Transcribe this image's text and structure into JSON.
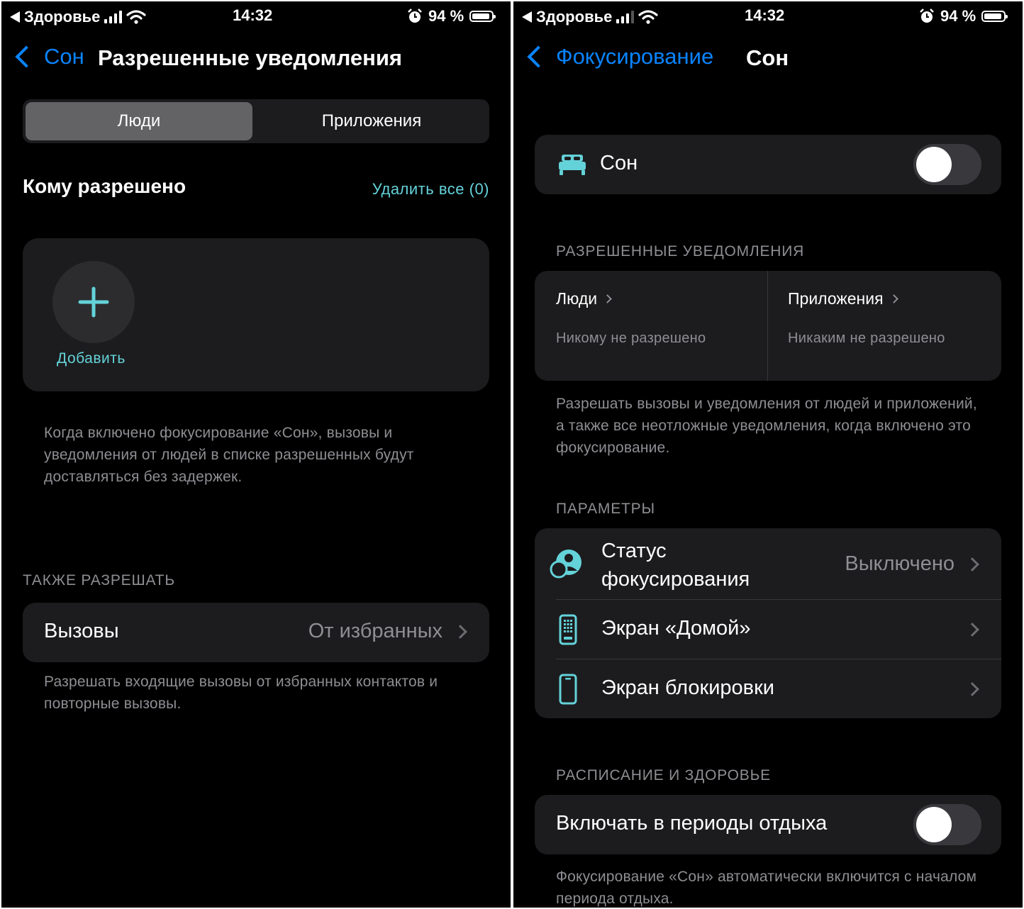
{
  "left_screen": {
    "status_bar": {
      "back_app": "Здоровье",
      "time": "14:32",
      "battery": "94 %",
      "battery_level": 0.94
    },
    "nav": {
      "back_label": "Сон",
      "title": "Разрешенные уведомления"
    },
    "segmented": {
      "tab_people": "Люди",
      "tab_apps": "Приложения",
      "selected": "Люди"
    },
    "allowed_section": {
      "title": "Кому разрешено",
      "remove_all": "Удалить все (0)"
    },
    "add_card": {
      "add_label": "Добавить"
    },
    "info_caption": "Когда включено фокусирование «Сон», вызовы и уведомления от людей в списке разрешенных будут доставляться без задержек.",
    "also_allow": {
      "header": "ТАКЖЕ РАЗРЕШАТЬ",
      "calls_label": "Вызовы",
      "calls_value": "От избранных",
      "caption": "Разрешать входящие вызовы от избранных контактов и повторные вызовы."
    }
  },
  "right_screen": {
    "status_bar": {
      "back_app": "Здоровье",
      "time": "14:32",
      "battery": "94 %",
      "battery_level": 0.94
    },
    "nav": {
      "back_label": "Фокусирование",
      "title": "Сон"
    },
    "sleep_row": {
      "label": "Сон",
      "toggle_on": false
    },
    "allowed_notifications": {
      "header": "РАЗРЕШЕННЫЕ УВЕДОМЛЕНИЯ",
      "people_title": "Люди",
      "people_value": "Никому не разрешено",
      "apps_title": "Приложения",
      "apps_value": "Никаким не разрешено",
      "caption": "Разрешать вызовы и уведомления от людей и приложений, а также все неотложные уведомления, когда включено это фокусирование."
    },
    "parameters": {
      "header": "ПАРАМЕТРЫ",
      "focus_status_line1": "Статус",
      "focus_status_line2": "фокусирования",
      "focus_status_value": "Выключено",
      "home_screen": "Экран «Домой»",
      "lock_screen": "Экран блокировки"
    },
    "schedule": {
      "header": "РАСПИСАНИЕ И ЗДОРОВЬЕ",
      "wind_down_label": "Включать в периоды отдыха",
      "toggle_on": false,
      "caption": "Фокусирование «Сон» автоматически включится с началом периода отдыха."
    }
  },
  "colors": {
    "accent_blue": "#0a84ff",
    "teal": "#64d2d9",
    "card": "#1c1c1e",
    "background": "#000000"
  }
}
